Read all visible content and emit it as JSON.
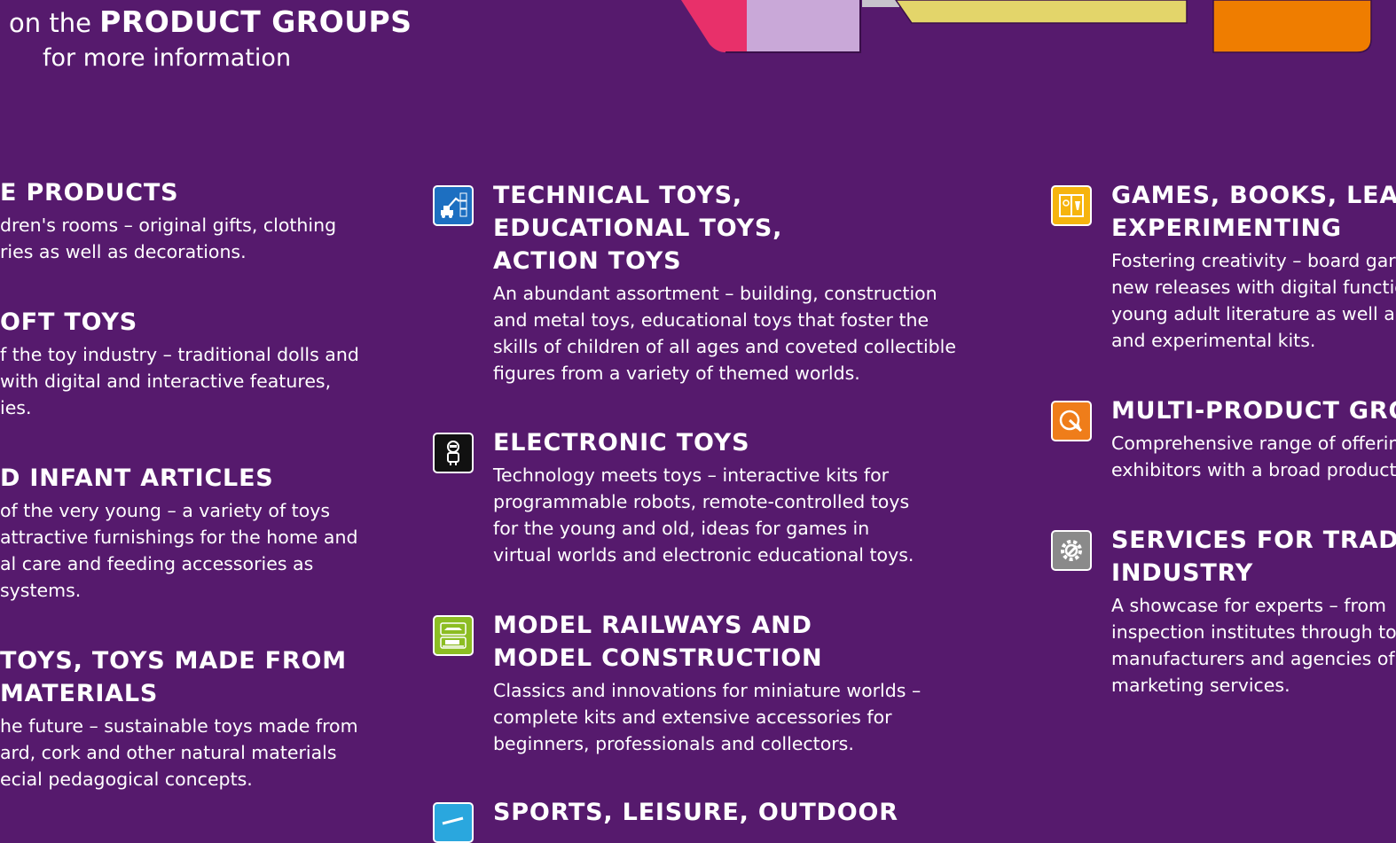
{
  "intro": {
    "prefix": "on the",
    "highlight": "PRODUCT GROUPS",
    "suffix": "for more information"
  },
  "left_groups": [
    {
      "title_lines": [
        "E PRODUCTS"
      ],
      "desc_lines": [
        "dren's rooms – original gifts, clothing",
        "ries as well as decorations."
      ]
    },
    {
      "title_lines": [
        "OFT TOYS"
      ],
      "desc_lines": [
        "f the toy industry – traditional dolls and",
        " with digital and interactive features,",
        "ies."
      ]
    },
    {
      "title_lines": [
        "D INFANT ARTICLES"
      ],
      "desc_lines": [
        " of the very young – a variety of toys",
        "attractive furnishings for the home and",
        "al care and feeding accessories as",
        "systems."
      ]
    },
    {
      "title_lines": [
        " TOYS, TOYS MADE FROM",
        " MATERIALS"
      ],
      "desc_lines": [
        "he future – sustainable toys made from",
        "ard, cork and other natural materials",
        "ecial pedagogical concepts."
      ]
    }
  ],
  "middle_groups": [
    {
      "icon": "excavator-abc-icon",
      "icon_color": "#1d6fc1",
      "title_lines": [
        "TECHNICAL TOYS,",
        "EDUCATIONAL TOYS,",
        "ACTION TOYS"
      ],
      "desc_lines": [
        "An abundant assortment – building, construction",
        "and metal toys, educational toys that foster the",
        "skills of children of all ages and coveted collectible",
        "figures from a variety of themed worlds."
      ]
    },
    {
      "icon": "robot-icon",
      "icon_color": "#111111",
      "title_lines": [
        "ELECTRONIC TOYS"
      ],
      "desc_lines": [
        "Technology meets toys – interactive kits for",
        "programmable robots, remote-controlled toys",
        "for the young and old, ideas for games in",
        "virtual worlds and electronic educational toys."
      ]
    },
    {
      "icon": "model-train-icon",
      "icon_color": "#8cbd23",
      "title_lines": [
        "MODEL RAILWAYS AND",
        "MODEL CONSTRUCTION"
      ],
      "desc_lines": [
        "Classics and innovations for miniature worlds –",
        "complete kits and extensive accessories for",
        "beginners, professionals and collectors."
      ]
    },
    {
      "icon": "sports-icon",
      "icon_color": "#2aa7de",
      "title_lines": [
        "SPORTS, LEISURE, OUTDOOR"
      ],
      "desc_lines": []
    }
  ],
  "right_groups": [
    {
      "icon": "book-game-icon",
      "icon_color": "#f6b40e",
      "title_lines": [
        "GAMES, BOOKS, LEAR",
        "EXPERIMENTING"
      ],
      "desc_lines": [
        "Fostering creativity – board gar",
        "new releases with digital functio",
        "young adult literature as well a",
        "and experimental kits."
      ]
    },
    {
      "icon": "multi-product-icon",
      "icon_color": "#ef7d1a",
      "title_lines": [
        "MULTI-PRODUCT GROU"
      ],
      "desc_lines": [
        "Comprehensive range of offerin",
        "exhibitors with a broad product"
      ]
    },
    {
      "icon": "gear-wrench-icon",
      "icon_color": "#8a8a8a",
      "title_lines": [
        "SERVICES FOR TRADE",
        "INDUSTRY"
      ],
      "desc_lines": [
        "A showcase for experts – from",
        "inspection institutes through to",
        "manufacturers and agencies of",
        "marketing services."
      ]
    }
  ],
  "colors": {
    "background": "#561a6d",
    "shape_pink": "#e8306a",
    "shape_lilac": "#c9a8d8",
    "shape_grey": "#c7c3cc",
    "shape_yellow": "#e3d56a",
    "shape_orange": "#ef7d00"
  }
}
